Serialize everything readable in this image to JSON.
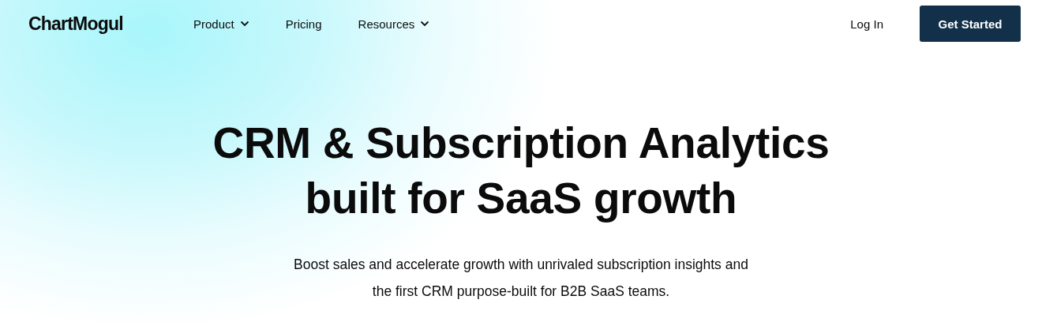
{
  "logo": "ChartMogul",
  "nav": [
    {
      "label": "Product",
      "kind": "dropdown"
    },
    {
      "label": "Pricing",
      "kind": "link"
    },
    {
      "label": "Resources",
      "kind": "dropdown"
    }
  ],
  "login": "Log In",
  "cta": "Get Started",
  "hero": {
    "title_lines": [
      "CRM & Subscription Analytics",
      "built for SaaS growth"
    ],
    "subtitle_lines": [
      "Boost sales and accelerate growth with unrivaled subscription insights and",
      "the first CRM purpose-built for B2B SaaS teams."
    ]
  }
}
